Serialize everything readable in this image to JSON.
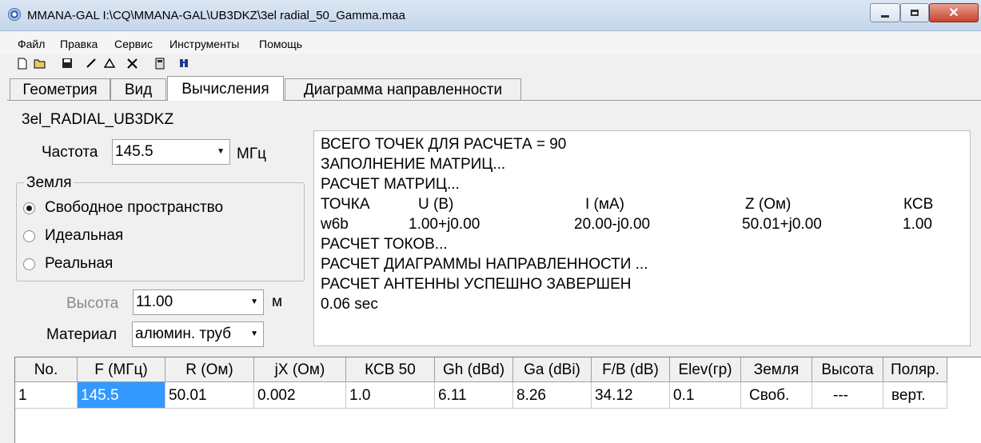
{
  "window": {
    "title": "MMANA-GAL I:\\CQ\\MMANA-GAL\\UB3DKZ\\3el radial_50_Gamma.maa"
  },
  "menu": [
    "Файл",
    "Правка",
    "Сервис",
    "Инструменты",
    "Помощь"
  ],
  "toolbar_icons": [
    "new-file-icon",
    "open-folder-icon",
    "save-disk-icon",
    "line-draw-icon",
    "triangle-icon",
    "tools-icon",
    "calculator-icon",
    "antenna-icon"
  ],
  "tabs": [
    "Геометрия",
    "Вид",
    "Вычисления",
    "Диаграмма направленности"
  ],
  "active_tab": "Вычисления",
  "antenna_name": "3el_RADIAL_UB3DKZ",
  "frequency": {
    "label": "Частота",
    "value": "145.5",
    "unit": "МГц"
  },
  "ground": {
    "title": "Земля",
    "options": [
      "Свободное пространство",
      "Идеальная",
      "Реальная"
    ],
    "selected": "Свободное пространство"
  },
  "height": {
    "label": "Высота",
    "value": "11.00",
    "unit": "м"
  },
  "material": {
    "label": "Материал",
    "value": "алюмин. труб"
  },
  "output": {
    "lines": [
      "ВСЕГО ТОЧЕК ДЛЯ РАСЧЕТА = 90",
      "ЗАПОЛНЕНИЕ МАТРИЦ...",
      "РАСЧЕТ МАТРИЦ..."
    ],
    "table_headers": [
      "ТОЧКА",
      "U (В)",
      "I (мА)",
      "Z (Ом)",
      "КСВ"
    ],
    "table_row": [
      "w6b",
      "1.00+j0.00",
      "20.00-j0.00",
      "50.01+j0.00",
      "1.00"
    ],
    "lines_after": [
      "РАСЧЕТ ТОКОВ...",
      "РАСЧЕТ ДИАГРАММЫ НАПРАВЛЕННОСТИ ...",
      "РАСЧЕТ АНТЕННЫ УСПЕШНО ЗАВЕРШЕН",
      "0.06 sec"
    ]
  },
  "results": {
    "headers": [
      "No.",
      "F (МГц)",
      "R (Ом)",
      "jX (Ом)",
      "КСВ 50",
      "Gh (dBd)",
      "Ga (dBi)",
      "F/B (dB)",
      "Elev(гр)",
      "Земля",
      "Высота",
      "Поляр."
    ],
    "rows": [
      [
        "1",
        "145.5",
        "50.01",
        "0.002",
        "1.0",
        "6.11",
        "8.26",
        "34.12",
        "0.1",
        "Своб.",
        "---",
        "верт."
      ]
    ]
  }
}
